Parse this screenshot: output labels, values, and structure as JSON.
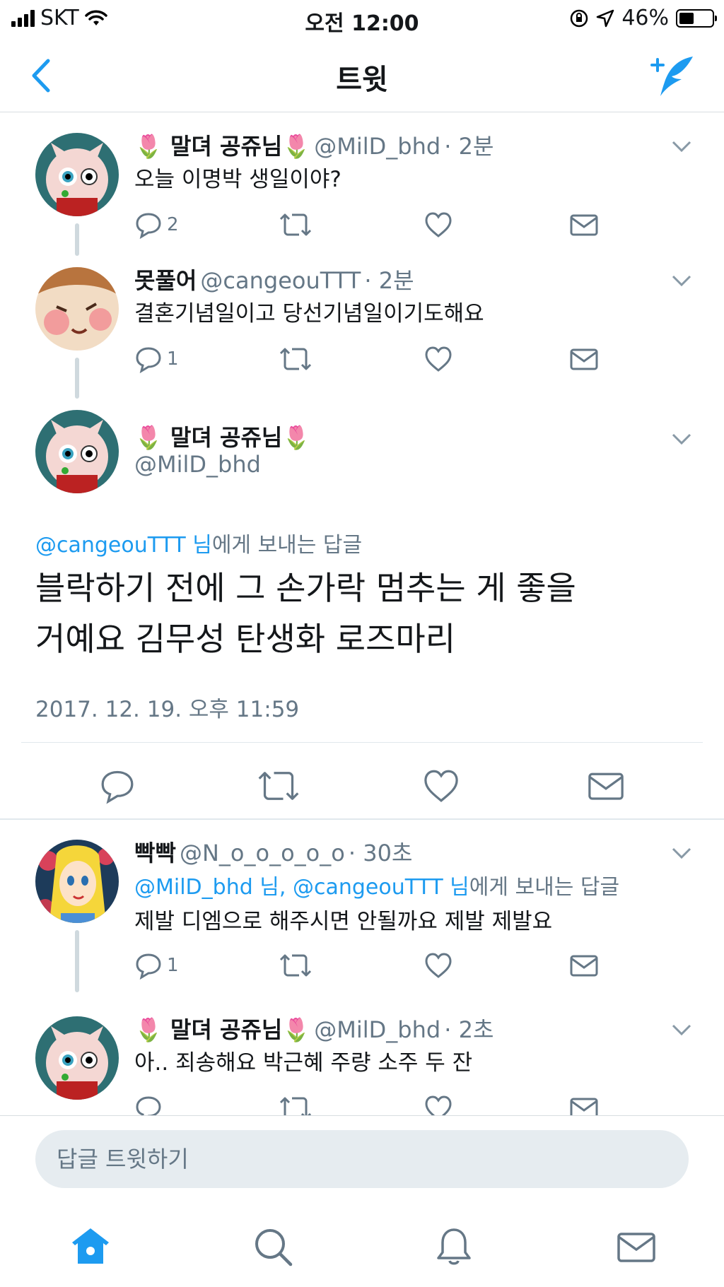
{
  "status_bar": {
    "carrier": "SKT",
    "time": "오전 12:00",
    "battery": "46%"
  },
  "nav": {
    "title": "트윗"
  },
  "thread": [
    {
      "display_name": "🌷 말뎌 공쥬님🌷",
      "handle": "@MilD_bhd",
      "time": "· 2분",
      "text": "오늘 이명박 생일이야?",
      "reply_count": "2"
    },
    {
      "display_name": "못풀어",
      "handle": "@cangeouTTT",
      "time": "· 2분",
      "text": "결혼기념일이고 당선기념일이기도해요",
      "reply_count": "1"
    }
  ],
  "main_tweet": {
    "display_name": "🌷 말뎌 공쥬님🌷",
    "handle": "@MilD_bhd",
    "reply_to_handle": "@cangeouTTT 님",
    "reply_to_suffix": "에게 보내는 답글",
    "text_line1": "블락하기 전에 그 손가락 멈추는 게 좋을",
    "text_line2": "거예요 김무성 탄생화 로즈마리",
    "timestamp": "2017. 12. 19. 오후 11:59"
  },
  "replies": [
    {
      "display_name": "빡빡",
      "handle": "@N_o_o_o_o_o",
      "time": "· 30초",
      "reply_to_handles": "@MilD_bhd 님, @cangeouTTT 님",
      "reply_to_suffix": "에게 보내는 답글",
      "text": "제발 디엠으로 해주시면 안될까요 제발 제발요",
      "reply_count": "1"
    },
    {
      "display_name": "🌷 말뎌 공쥬님🌷",
      "handle": "@MilD_bhd",
      "time": "· 2초",
      "text": "아.. 죄송해요 박근혜 주량 소주 두 잔"
    }
  ],
  "reply_box": {
    "placeholder": "답글 트윗하기"
  },
  "colors": {
    "accent": "#1d9bf0",
    "gray_text": "#657786",
    "divider": "#e1e8ed"
  },
  "icons": [
    "back-chevron-icon",
    "compose-tweet-icon",
    "reply-icon",
    "retweet-icon",
    "like-icon",
    "dm-icon",
    "home-icon",
    "search-icon",
    "notifications-icon",
    "messages-icon"
  ]
}
